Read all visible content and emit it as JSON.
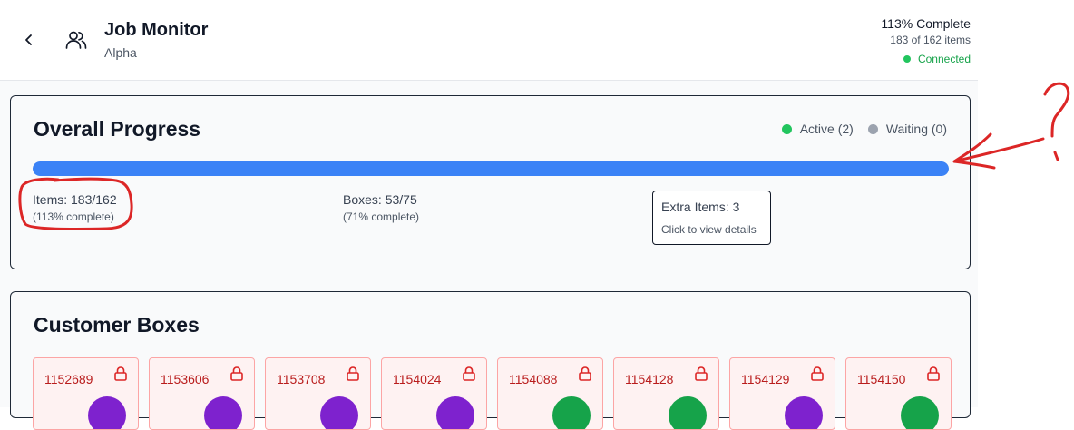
{
  "header": {
    "title": "Job Monitor",
    "subtitle": "Alpha",
    "progress_text": "113% Complete",
    "items_text": "183 of 162 items",
    "connection_status": "Connected",
    "back_icon": "chevron-left-icon",
    "users_icon": "users-icon"
  },
  "overall": {
    "title": "Overall Progress",
    "legend": [
      {
        "label": "Active (2)",
        "color": "#22c55e"
      },
      {
        "label": "Waiting (0)",
        "color": "#9ca3af"
      }
    ],
    "progress_fraction": 1.0,
    "items_label": "Items: 183/162",
    "items_sub": "(113% complete)",
    "boxes_label": "Boxes: 53/75",
    "boxes_sub": "(71% complete)",
    "extra_label": "Extra Items: 3",
    "extra_sub": "Click to view details"
  },
  "customer_boxes": {
    "title": "Customer Boxes",
    "items": [
      {
        "id": "1152689",
        "status_color": "#7e22ce"
      },
      {
        "id": "1153606",
        "status_color": "#7e22ce"
      },
      {
        "id": "1153708",
        "status_color": "#7e22ce"
      },
      {
        "id": "1154024",
        "status_color": "#7e22ce"
      },
      {
        "id": "1154088",
        "status_color": "#16a34a"
      },
      {
        "id": "1154128",
        "status_color": "#16a34a"
      },
      {
        "id": "1154129",
        "status_color": "#7e22ce"
      },
      {
        "id": "1154150",
        "status_color": "#16a34a"
      }
    ]
  },
  "annotation": {
    "mark": "?",
    "color": "#dc2626"
  }
}
